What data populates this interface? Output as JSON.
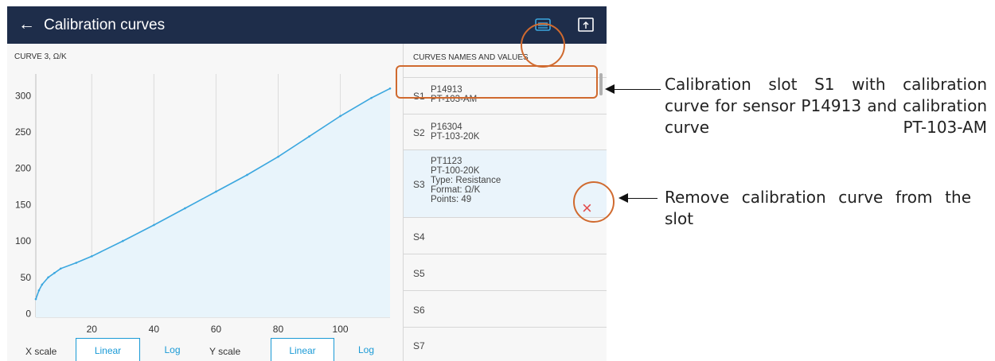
{
  "header": {
    "title": "Calibration curves",
    "back": "←"
  },
  "chart_panel": {
    "curve_label": "CURVE 3, Ω/K"
  },
  "chart_data": {
    "type": "area",
    "title": "CURVE 3, Ω/K",
    "xlabel": "",
    "ylabel": "",
    "xlim": [
      2,
      116
    ],
    "ylim": [
      -5,
      330
    ],
    "xticks": [
      20,
      40,
      60,
      80,
      100
    ],
    "yticks": [
      0,
      50,
      100,
      150,
      200,
      250,
      300
    ],
    "grid": "vertical",
    "series": [
      {
        "line_color": "#3ba7df",
        "fill_color": "#e8f4fb",
        "x": [
          2,
          3,
          4,
          6,
          8,
          10,
          15,
          20,
          30,
          40,
          50,
          60,
          70,
          80,
          90,
          100,
          110,
          116
        ],
        "y": [
          20,
          32,
          40,
          50,
          56,
          62,
          70,
          79,
          100,
          122,
          145,
          168,
          191,
          216,
          244,
          272,
          297,
          310
        ]
      }
    ]
  },
  "scales": {
    "x_label": "X scale",
    "x_linear": "Linear",
    "x_log": "Log",
    "y_label": "Y scale",
    "y_linear": "Linear",
    "y_log": "Log",
    "x_active": "Linear",
    "y_active": "Linear"
  },
  "list": {
    "header": "CURVES NAMES AND VALUES",
    "slots": [
      {
        "id": "S1",
        "lines": [
          "P14913",
          "PT-103-AM"
        ]
      },
      {
        "id": "S2",
        "lines": [
          "P16304",
          "PT-103-20K"
        ]
      },
      {
        "id": "S3",
        "lines": [
          "PT1123",
          "PT-100-20K",
          "Type: Resistance",
          "Format: Ω/K",
          "Points: 49"
        ]
      },
      {
        "id": "S4",
        "lines": []
      },
      {
        "id": "S5",
        "lines": []
      },
      {
        "id": "S6",
        "lines": []
      },
      {
        "id": "S7",
        "lines": []
      }
    ],
    "remove_symbol": "×"
  },
  "annotations": {
    "slot_callout": "Calibration slot S1 with calibration curve for sensor P14913 and calibration curve PT-103-AM",
    "remove_callout": "Remove calibration curve from the slot"
  },
  "colors": {
    "topbar": "#1e2d4a",
    "accent": "#1a9ad6",
    "highlight": "#d06a2f",
    "remove": "#e34b4b"
  }
}
